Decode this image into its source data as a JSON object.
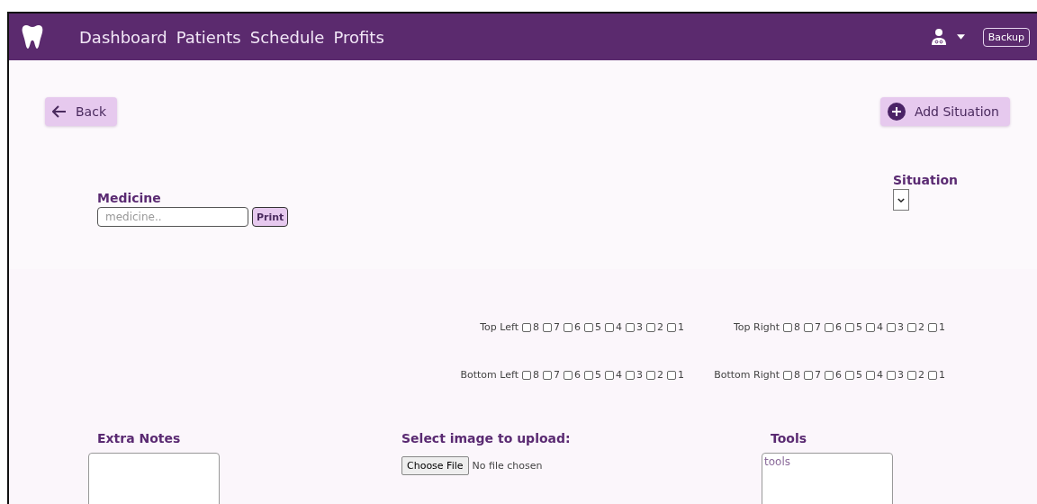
{
  "nav": {
    "links": [
      {
        "label": "Dashboard"
      },
      {
        "label": "Patients"
      },
      {
        "label": "Schedule"
      },
      {
        "label": "Profits"
      }
    ],
    "backup": "Backup"
  },
  "back_button": "Back",
  "add_button": "Add Situation",
  "medicine": {
    "label": "Medicine",
    "placeholder": "medicine..",
    "print": "Print"
  },
  "situation": {
    "label": "Situation"
  },
  "quadrants": [
    {
      "label": "Top Left",
      "teeth": [
        {
          "number": "8",
          "checked": false
        },
        {
          "number": "7",
          "checked": false
        },
        {
          "number": "6",
          "checked": false
        },
        {
          "number": "5",
          "checked": false
        },
        {
          "number": "4",
          "checked": false
        },
        {
          "number": "3",
          "checked": false
        },
        {
          "number": "2",
          "checked": false
        },
        {
          "number": "1",
          "checked": false
        }
      ]
    },
    {
      "label": "Top Right",
      "teeth": [
        {
          "number": "8",
          "checked": false
        },
        {
          "number": "7",
          "checked": false
        },
        {
          "number": "6",
          "checked": false
        },
        {
          "number": "5",
          "checked": false
        },
        {
          "number": "4",
          "checked": false
        },
        {
          "number": "3",
          "checked": false
        },
        {
          "number": "2",
          "checked": false
        },
        {
          "number": "1",
          "checked": false
        }
      ]
    },
    {
      "label": "Bottom Left",
      "teeth": [
        {
          "number": "8",
          "checked": false
        },
        {
          "number": "7",
          "checked": false
        },
        {
          "number": "6",
          "checked": false
        },
        {
          "number": "5",
          "checked": false
        },
        {
          "number": "4",
          "checked": false
        },
        {
          "number": "3",
          "checked": false
        },
        {
          "number": "2",
          "checked": false
        },
        {
          "number": "1",
          "checked": false
        }
      ]
    },
    {
      "label": "Bottom Right",
      "teeth": [
        {
          "number": "8",
          "checked": false
        },
        {
          "number": "7",
          "checked": false
        },
        {
          "number": "6",
          "checked": false
        },
        {
          "number": "5",
          "checked": false
        },
        {
          "number": "4",
          "checked": false
        },
        {
          "number": "3",
          "checked": false
        },
        {
          "number": "2",
          "checked": false
        },
        {
          "number": "1",
          "checked": false
        }
      ]
    }
  ],
  "extra_notes": {
    "label": "Extra Notes"
  },
  "upload": {
    "label": "Select image to upload:",
    "button": "Choose File",
    "status": "No file chosen"
  },
  "tools": {
    "label": "Tools",
    "placeholder": "tools"
  }
}
